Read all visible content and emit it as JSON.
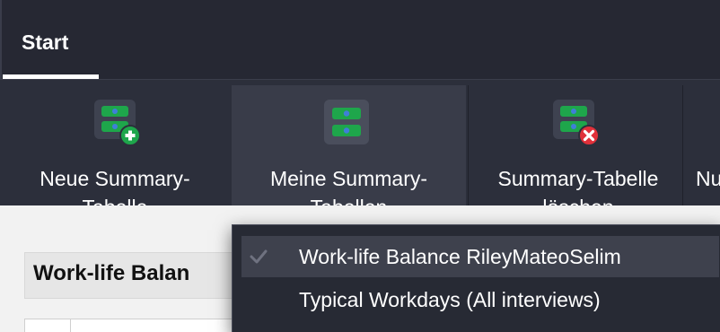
{
  "tabs": {
    "start_label": "Start"
  },
  "ribbon": {
    "new_table": {
      "line1": "Neue Summary-",
      "line2": "Tabelle"
    },
    "my_tables": {
      "line1": "Meine Summary-",
      "line2": "Tabellen"
    },
    "delete_table": {
      "line1": "Summary-Tabelle",
      "line2": "löschen"
    },
    "partial": {
      "line1": "Nu"
    }
  },
  "document": {
    "title": "Work-life Balan"
  },
  "dropdown": {
    "items": [
      {
        "label": "Work-life Balance RileyMateoSelim",
        "checked": true
      },
      {
        "label": "Typical Workdays (All interviews)",
        "checked": false
      }
    ]
  },
  "colors": {
    "icon_green": "#1ea64b",
    "icon_blue": "#3f7fd8",
    "badge_add": "#1ea64b",
    "badge_delete": "#e0303a",
    "ribbon_bg": "#2c2f3b",
    "menu_bg": "#272a34"
  }
}
